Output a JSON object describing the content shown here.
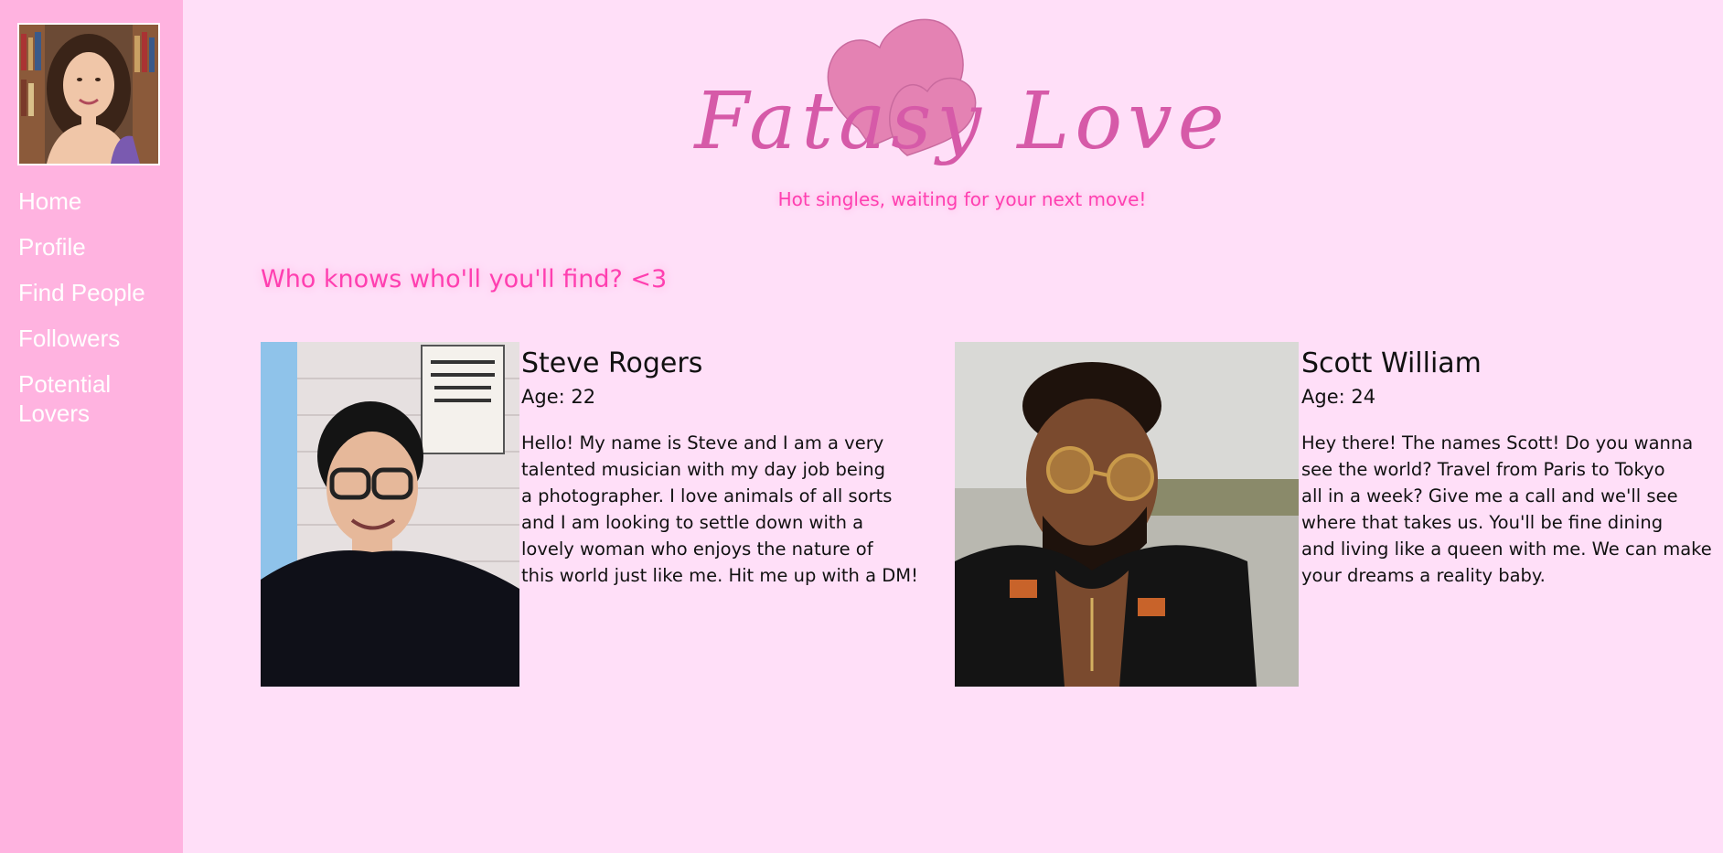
{
  "sidebar": {
    "avatar_alt": "profile photo",
    "nav": [
      {
        "label": "Home"
      },
      {
        "label": "Profile"
      },
      {
        "label": "Find People"
      },
      {
        "label": "Followers"
      },
      {
        "label": "Potential Lovers"
      }
    ]
  },
  "header": {
    "logo_text": "Fatasy Love",
    "tagline": "Hot singles, waiting for your next move!"
  },
  "main": {
    "section_title": "Who knows who'll you'll find? <3",
    "profiles": [
      {
        "name": "Steve Rogers",
        "age": "Age: 22",
        "bio_lines": [
          "Hello! My name is Steve and I am a very",
          "talented musician with my day job being",
          "a photographer. I love animals of all sorts",
          "and I am looking to settle down with a",
          "lovely woman who enjoys the nature of",
          "this world just like me. Hit me up with a DM!"
        ]
      },
      {
        "name": "Scott William",
        "age": "Age: 24",
        "bio_lines": [
          "Hey there! The names Scott! Do you wanna",
          "see the world? Travel from Paris to Tokyo",
          "all in a week? Give me a call and we'll see",
          "where that takes us. You'll be fine dining",
          "and living like a queen with me. We can make",
          "your dreams a reality baby."
        ]
      }
    ]
  },
  "colors": {
    "page_bg": "#ffdff8",
    "sidebar_bg": "#ffb3e0",
    "accent_pink": "#ff3fb0",
    "logo_pink": "#d65aa8",
    "heart_pink": "#e482b3"
  }
}
